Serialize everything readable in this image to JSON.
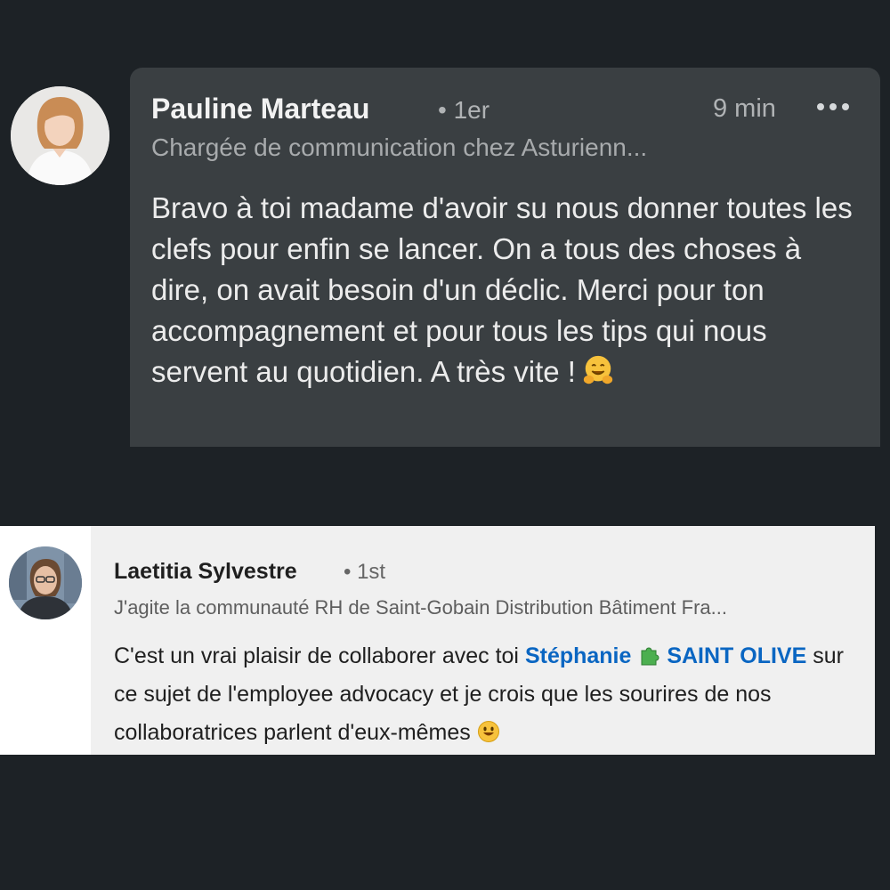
{
  "comment1": {
    "author": "Pauline Marteau",
    "degree": "• 1er",
    "time": "9 min",
    "more_icon": "ellipsis-icon",
    "headline": "Chargée de communication chez Asturienn...",
    "body": "Bravo à toi madame d'avoir su nous donner toutes les clefs pour enfin se lancer. On a tous des choses à dire, on avait besoin d'un déclic. Merci pour ton accompagnement et pour tous les tips qui nous servent au quotidien. A très vite !",
    "emoji": "hugging-face-emoji"
  },
  "comment2": {
    "author": "Laetitia Sylvestre",
    "degree": "• 1st",
    "headline": "J'agite la communauté RH de Saint-Gobain Distribution Bâtiment Fra...",
    "body_before": "C'est un vrai plaisir de collaborer avec toi ",
    "mention_first": "Stéphanie",
    "mention_emoji": "puzzle-piece-emoji",
    "mention_last": "SAINT OLIVE",
    "body_after": " sur ce sujet de l'employee advocacy et je crois que les sourires de nos collaboratrices parlent d'eux-mêmes",
    "emoji": "smiling-face-emoji",
    "mention_color": "#0a66c2"
  },
  "colors": {
    "background": "#1d2226",
    "dark_bubble": "#3a3f42",
    "light_bubble": "#f0f0f0"
  }
}
